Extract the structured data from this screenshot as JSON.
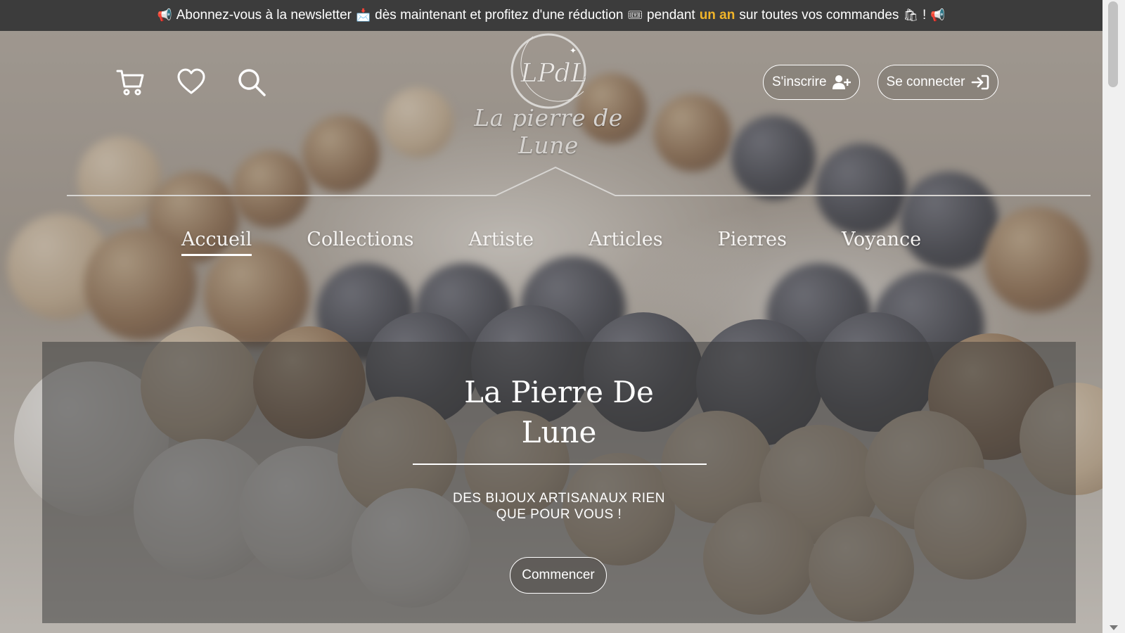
{
  "announcement": {
    "part1": "Abonnez-vous à la newsletter",
    "part2": "dès maintenant et profitez d'une réduction",
    "part3": "pendant",
    "highlight": "un an",
    "part4": "sur toutes vos commandes",
    "part5": "!",
    "highlight_color": "#f0b429"
  },
  "header": {
    "icons": [
      "cart-icon",
      "heart-icon",
      "search-icon"
    ],
    "logo_monogram": "LPdL",
    "logo_title": "La pierre de Lune",
    "signup_label": "S'inscrire",
    "login_label": "Se connecter"
  },
  "nav": {
    "items": [
      {
        "label": "Accueil",
        "active": true
      },
      {
        "label": "Collections",
        "active": false
      },
      {
        "label": "Artiste",
        "active": false
      },
      {
        "label": "Articles",
        "active": false
      },
      {
        "label": "Pierres",
        "active": false
      },
      {
        "label": "Voyance",
        "active": false
      }
    ]
  },
  "hero": {
    "title_line1": "La Pierre De",
    "title_line2": "Lune",
    "subtitle_line1": "DES BIJOUX ARTISANAUX RIEN",
    "subtitle_line2": "QUE POUR VOUS !",
    "cta_label": "Commencer"
  }
}
